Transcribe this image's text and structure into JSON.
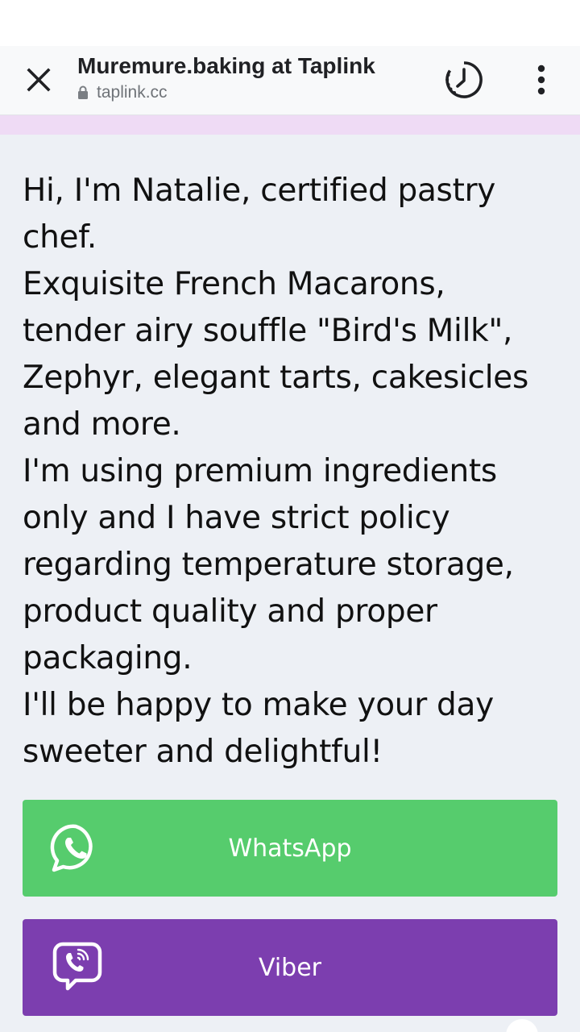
{
  "browser": {
    "page_title": "Muremure.baking at Taplink",
    "url": "taplink.cc",
    "close_icon": "close-icon",
    "lock_icon": "lock-icon",
    "history_icon": "history-icon",
    "menu_icon": "more-vert-icon"
  },
  "colors": {
    "accent_strip": "#efdbf5",
    "background": "#edf0f5",
    "whatsapp": "#56cc6d",
    "viber": "#7c3eaf"
  },
  "bio": {
    "lines": [
      "Hi, I'm Natalie, certified pastry",
      "chef.",
      "Exquisite French Macarons,",
      "tender airy souffle \"Bird's Milk\",",
      "Zephyr, elegant tarts, cakesicles",
      "and more.",
      "I'm using premium ingredients",
      "only and I have strict policy",
      "regarding temperature storage,",
      "product quality and proper",
      "packaging.",
      "I'll be happy to make your day",
      "sweeter and delightful!"
    ]
  },
  "buttons": {
    "whatsapp": {
      "label": "WhatsApp",
      "icon": "whatsapp-icon"
    },
    "viber": {
      "label": "Viber",
      "icon": "viber-icon"
    }
  }
}
